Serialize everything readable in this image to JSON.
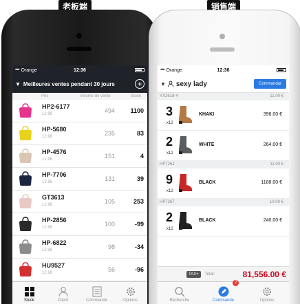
{
  "labels": {
    "left": "老板端",
    "right": "销售端"
  },
  "left_phone": {
    "status": {
      "dots": "•••••",
      "carrier": "Orange",
      "time": "12:36"
    },
    "title": "Meilleures ventes pendant 30 jours",
    "columns": {
      "price": "Prix",
      "volume": "Volume de vente",
      "stock": "Stock"
    },
    "rows": [
      {
        "code": "HP2-6177",
        "price": "12.98",
        "volume": "494",
        "stock": "1100",
        "thumb": "pink-heel-shoe",
        "color": "#e6348c"
      },
      {
        "code": "HP-5680",
        "price": "12.98",
        "volume": "235",
        "stock": "83",
        "thumb": "yellow-sandal",
        "color": "#e8d31c"
      },
      {
        "code": "HP-4576",
        "price": "12.98",
        "volume": "151",
        "stock": "4",
        "thumb": "beige-clutch",
        "color": "#d9c7b3"
      },
      {
        "code": "HP-7706",
        "price": "12.98",
        "volume": "131",
        "stock": "39",
        "thumb": "navy-handbag",
        "color": "#1c2540"
      },
      {
        "code": "GT3613",
        "price": "12.98",
        "volume": "105",
        "stock": "253",
        "thumb": "pink-tote",
        "color": "#e8c9c5"
      },
      {
        "code": "HP-2856",
        "price": "12.98",
        "volume": "100",
        "stock": "-99",
        "thumb": "black-handbag",
        "color": "#2a2a2a"
      },
      {
        "code": "HP-6822",
        "price": "12.98",
        "volume": "98",
        "stock": "-34",
        "thumb": "grey-handbag",
        "color": "#8c8c8c"
      },
      {
        "code": "HU9527",
        "price": "12.98",
        "volume": "56",
        "stock": "-96",
        "thumb": "red-wallet",
        "color": "#d32f2f"
      }
    ],
    "tabs": [
      {
        "label": "Stock",
        "icon": "grid-icon",
        "active": true
      },
      {
        "label": "Client",
        "icon": "person-icon",
        "active": false
      },
      {
        "label": "Commande",
        "icon": "list-icon",
        "active": false
      },
      {
        "label": "Options",
        "icon": "gear-icon",
        "active": false
      }
    ]
  },
  "right_phone": {
    "status": {
      "dots": "•••••",
      "carrier": "Orange",
      "time": "12:36"
    },
    "client_name": "sexy lady",
    "order_button": "Commandar",
    "groups": [
      {
        "code": "YX2618-4",
        "price": "11.00 €",
        "items": [
          {
            "qty": "3",
            "mult": "x12",
            "color": "KHAKI",
            "amount": "396.00 €",
            "boot": "tan-boot",
            "hex": "#b47a45"
          },
          {
            "qty": "2",
            "mult": "x12",
            "color": "WHITE",
            "amount": "264.00 €",
            "boot": "grey-boot",
            "hex": "#5a5d61"
          }
        ]
      },
      {
        "code": "HP7262",
        "price": "11.00 €",
        "items": [
          {
            "qty": "9",
            "mult": "x12",
            "color": "BLACK",
            "amount": "1188.00 €",
            "boot": "red-boot",
            "hex": "#c62828"
          }
        ]
      },
      {
        "code": "HP7267",
        "price": "10.00 €",
        "items": [
          {
            "qty": "2",
            "mult": "x12",
            "color": "BLACK",
            "amount": "240.00 €",
            "boot": "black-red-boot",
            "hex": "#222222"
          }
        ]
      }
    ],
    "total": {
      "tax": "TAX+",
      "label": "Total:",
      "value": "81,556.00 €"
    },
    "tabs": [
      {
        "label": "Recherche",
        "icon": "search-icon"
      },
      {
        "label": "Commande",
        "icon": "pencil-icon",
        "badge": "2"
      },
      {
        "label": "Options",
        "icon": "gear-icon"
      }
    ]
  }
}
